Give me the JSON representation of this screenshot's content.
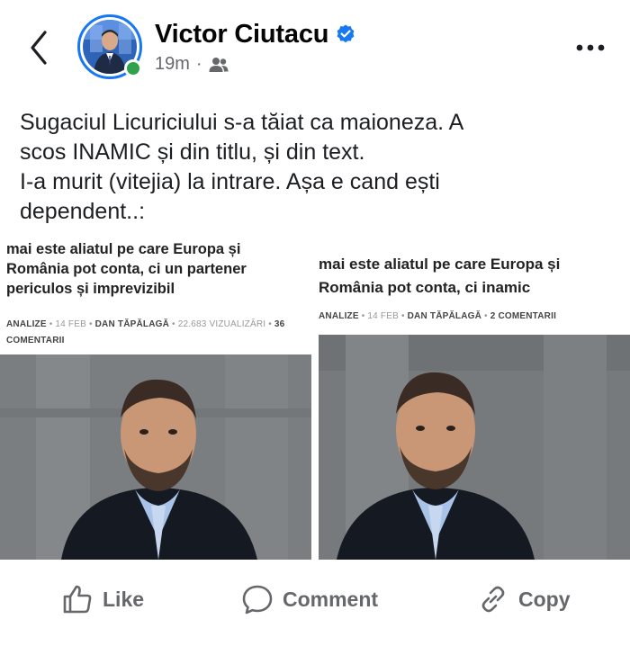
{
  "header": {
    "author_name": "Victor Ciutacu",
    "timestamp": "19m",
    "separator": "·",
    "audience_icon": "friends-icon",
    "verified_icon": "verified-badge-icon",
    "back_icon": "chevron-left-icon",
    "more_icon": "more-horizontal-icon"
  },
  "post": {
    "lines": [
      "Sugaciul Licuriciului s-a tăiat ca maioneza. A",
      "scos INAMIC și din titlu, și din text.",
      "I-a murit (vitejia) la intrare. Așa e cand ești",
      "dependent..:"
    ]
  },
  "attachments": [
    {
      "title_lines": [
        "mai este aliatul pe care Europa și",
        "România pot conta, ci un partener",
        "periculos și imprevizibil"
      ],
      "section": "ANALIZE",
      "date": "14 FEB",
      "author": "DAN TĂPĂLAGĂ",
      "views": "22.683 VIZUALIZĂRI",
      "comments_line1": "36",
      "comments_line2": "COMENTARII"
    },
    {
      "title_lines": [
        "mai este aliatul pe care Europa și",
        "România pot conta, ci inamic"
      ],
      "section": "ANALIZE",
      "date": "14 FEB",
      "author": "DAN TĂPĂLAGĂ",
      "comments": "2 COMENTARII"
    }
  ],
  "actions": {
    "like": "Like",
    "comment": "Comment",
    "copy": "Copy"
  },
  "colors": {
    "accent": "#1877f2",
    "online": "#31a24c",
    "secondary_text": "#65676b"
  }
}
